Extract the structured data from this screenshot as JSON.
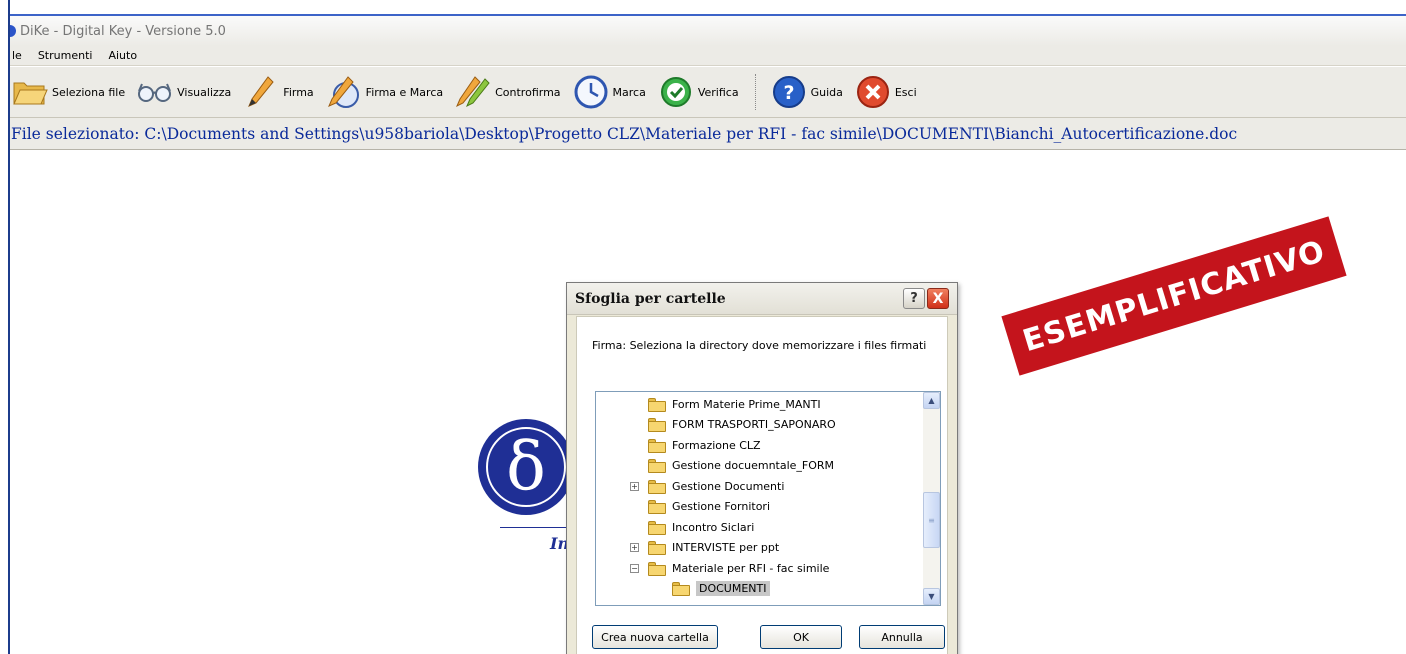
{
  "window": {
    "title": "DiKe - Digital Key - Versione 5.0"
  },
  "menu": [
    {
      "label": "le"
    },
    {
      "label": "Strumenti"
    },
    {
      "label": "Aiuto"
    }
  ],
  "toolbar": {
    "buttons": [
      {
        "label": "Seleziona file",
        "icon": "folder-open-icon"
      },
      {
        "label": "Visualizza",
        "icon": "glasses-icon"
      },
      {
        "label": "Firma",
        "icon": "pen-icon"
      },
      {
        "label": "Firma e Marca",
        "icon": "pen-clock-icon"
      },
      {
        "label": "Controfirma",
        "icon": "double-pen-icon"
      },
      {
        "label": "Marca",
        "icon": "clock-icon"
      },
      {
        "label": "Verifica",
        "icon": "check-icon"
      },
      {
        "label": "Guida",
        "icon": "help-icon"
      },
      {
        "label": "Esci",
        "icon": "exit-icon"
      }
    ]
  },
  "file_bar": {
    "text": "File selezionato: C:\\Documents and Settings\\u958bariola\\Desktop\\Progetto CLZ\\Materiale per RFI - fac simile\\DOCUMENTI\\Bianchi_Autocertificazione.doc"
  },
  "logo": {
    "symbol": "δ",
    "text": "In"
  },
  "stamp": {
    "text": "ESEMPLIFICATIVO",
    "color": "#c4141c"
  },
  "dialog": {
    "title": "Sfoglia per cartelle",
    "help": "?",
    "close": "X",
    "prompt": "Firma: Seleziona la directory dove memorizzare i files firmati",
    "tree": [
      {
        "name": "Form Materie Prime_MANTI",
        "expander": "",
        "level": 1
      },
      {
        "name": "FORM TRASPORTI_SAPONARO",
        "expander": "",
        "level": 1
      },
      {
        "name": "Formazione CLZ",
        "expander": "",
        "level": 1
      },
      {
        "name": "Gestione docuemntale_FORM",
        "expander": "",
        "level": 1
      },
      {
        "name": "Gestione Documenti",
        "expander": "+",
        "level": 1
      },
      {
        "name": "Gestione Fornitori",
        "expander": "",
        "level": 1
      },
      {
        "name": "Incontro Siclari",
        "expander": "",
        "level": 1
      },
      {
        "name": "INTERVISTE per ppt",
        "expander": "+",
        "level": 1
      },
      {
        "name": "Materiale per RFI - fac simile",
        "expander": "−",
        "level": 1
      },
      {
        "name": "DOCUMENTI",
        "expander": "",
        "level": 2,
        "selected": true
      }
    ],
    "buttons": {
      "new_folder": "Crea nuova cartella",
      "ok": "OK",
      "cancel": "Annulla"
    }
  }
}
